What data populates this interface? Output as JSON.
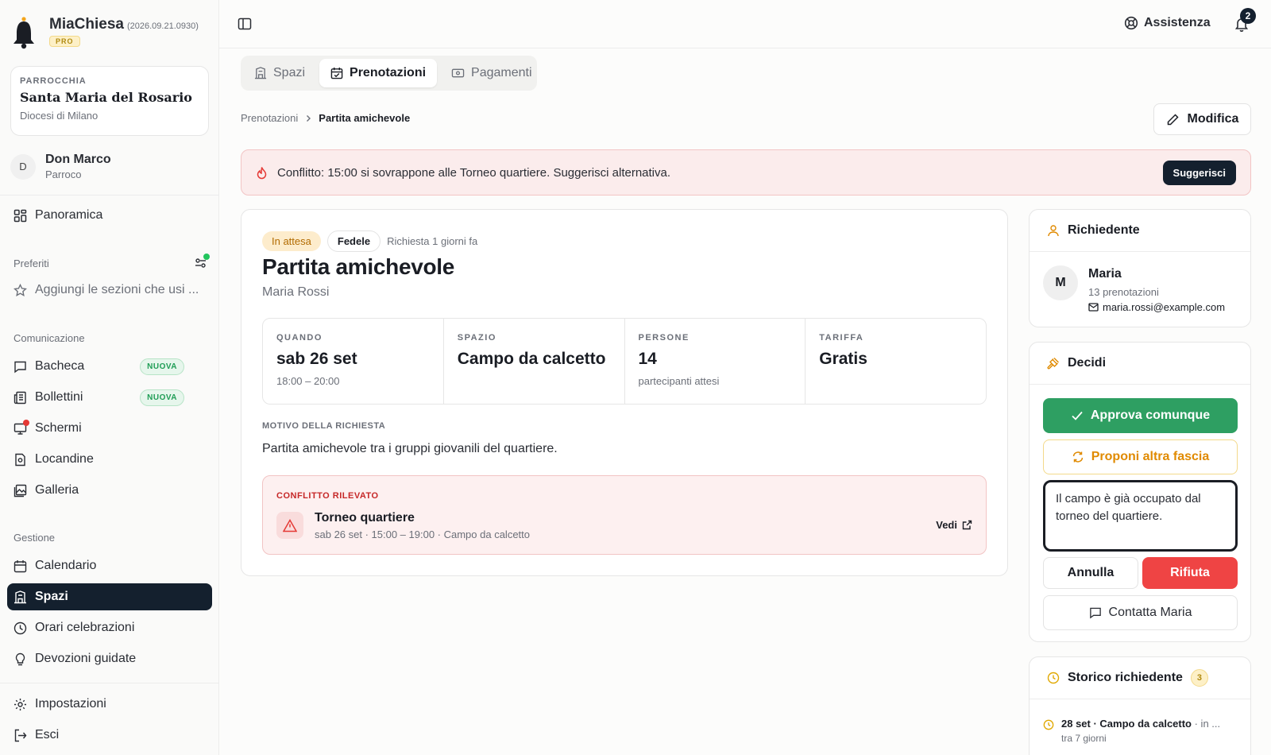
{
  "app": {
    "name": "MiaChiesa",
    "version": "(2026.09.21.0930)",
    "plan_badge": "PRO"
  },
  "parish": {
    "kicker": "PARROCCHIA",
    "name": "Santa Maria del Rosario",
    "diocese": "Diocesi di Milano"
  },
  "user": {
    "initial": "D",
    "name": "Don Marco",
    "role": "Parroco"
  },
  "sidebar": {
    "overview": "Panoramica",
    "favorites_label": "Preferiti",
    "favorites_hint": "Aggiungi le sezioni che usi ...",
    "comm_label": "Comunicazione",
    "comm_items": [
      {
        "label": "Bacheca",
        "badge": "NUOVA"
      },
      {
        "label": "Bollettini",
        "badge": "NUOVA"
      },
      {
        "label": "Schermi",
        "badge": ""
      },
      {
        "label": "Locandine",
        "badge": ""
      },
      {
        "label": "Galleria",
        "badge": ""
      }
    ],
    "mgmt_label": "Gestione",
    "mgmt_items": [
      "Calendario",
      "Spazi",
      "Orari celebrazioni",
      "Devozioni guidate"
    ],
    "active_item": "Spazi",
    "settings": "Impostazioni",
    "logout": "Esci"
  },
  "topbar": {
    "help": "Assistenza",
    "notif_count": "2"
  },
  "tabs": [
    "Spazi",
    "Prenotazioni",
    "Pagamenti"
  ],
  "active_tab": "Prenotazioni",
  "breadcrumb": {
    "parent": "Prenotazioni",
    "current": "Partita amichevole"
  },
  "edit_label": "Modifica",
  "alert": {
    "text": "Conflitto: 15:00 si sovrappone alle Torneo quartiere. Suggerisci alternativa.",
    "action": "Suggerisci"
  },
  "booking": {
    "status": "In attesa",
    "role": "Fedele",
    "requested": "Richiesta 1 giorni fa",
    "title": "Partita amichevole",
    "requester": "Maria Rossi",
    "facts": [
      {
        "key": "QUANDO",
        "value": "sab 26 set",
        "sub": "18:00 – 20:00"
      },
      {
        "key": "SPAZIO",
        "value": "Campo da calcetto",
        "sub": ""
      },
      {
        "key": "PERSONE",
        "value": "14",
        "sub": "partecipanti attesi"
      },
      {
        "key": "TARIFFA",
        "value": "Gratis",
        "sub": ""
      }
    ],
    "reason_label": "MOTIVO DELLA RICHIESTA",
    "reason": "Partita amichevole tra i gruppi giovanili del quartiere.",
    "conflict": {
      "label": "CONFLITTO RILEVATO",
      "title": "Torneo quartiere",
      "detail": "sab 26 set · 15:00 – 19:00 · Campo da calcetto",
      "link": "Vedi"
    }
  },
  "requester_panel": {
    "title": "Richiedente",
    "initial": "M",
    "name": "Maria",
    "count": "13 prenotazioni",
    "email": "maria.rossi@example.com"
  },
  "decide_panel": {
    "title": "Decidi",
    "approve": "Approva comunque",
    "propose": "Proponi altra fascia",
    "reason_text": "Il campo è già occupato dal torneo del quartiere.",
    "cancel": "Annulla",
    "reject": "Rifiuta",
    "contact": "Contatta Maria"
  },
  "history_panel": {
    "title": "Storico richiedente",
    "count": "3",
    "item_title": "28 set · Campo da calcetto",
    "item_suffix": " · in ...",
    "item_sub": "tra 7 giorni"
  },
  "colors": {
    "accent_dark": "#14202e",
    "approve": "#2e9f62",
    "reject": "#ef4444",
    "warning": "#e08a00",
    "danger": "#c62828"
  }
}
